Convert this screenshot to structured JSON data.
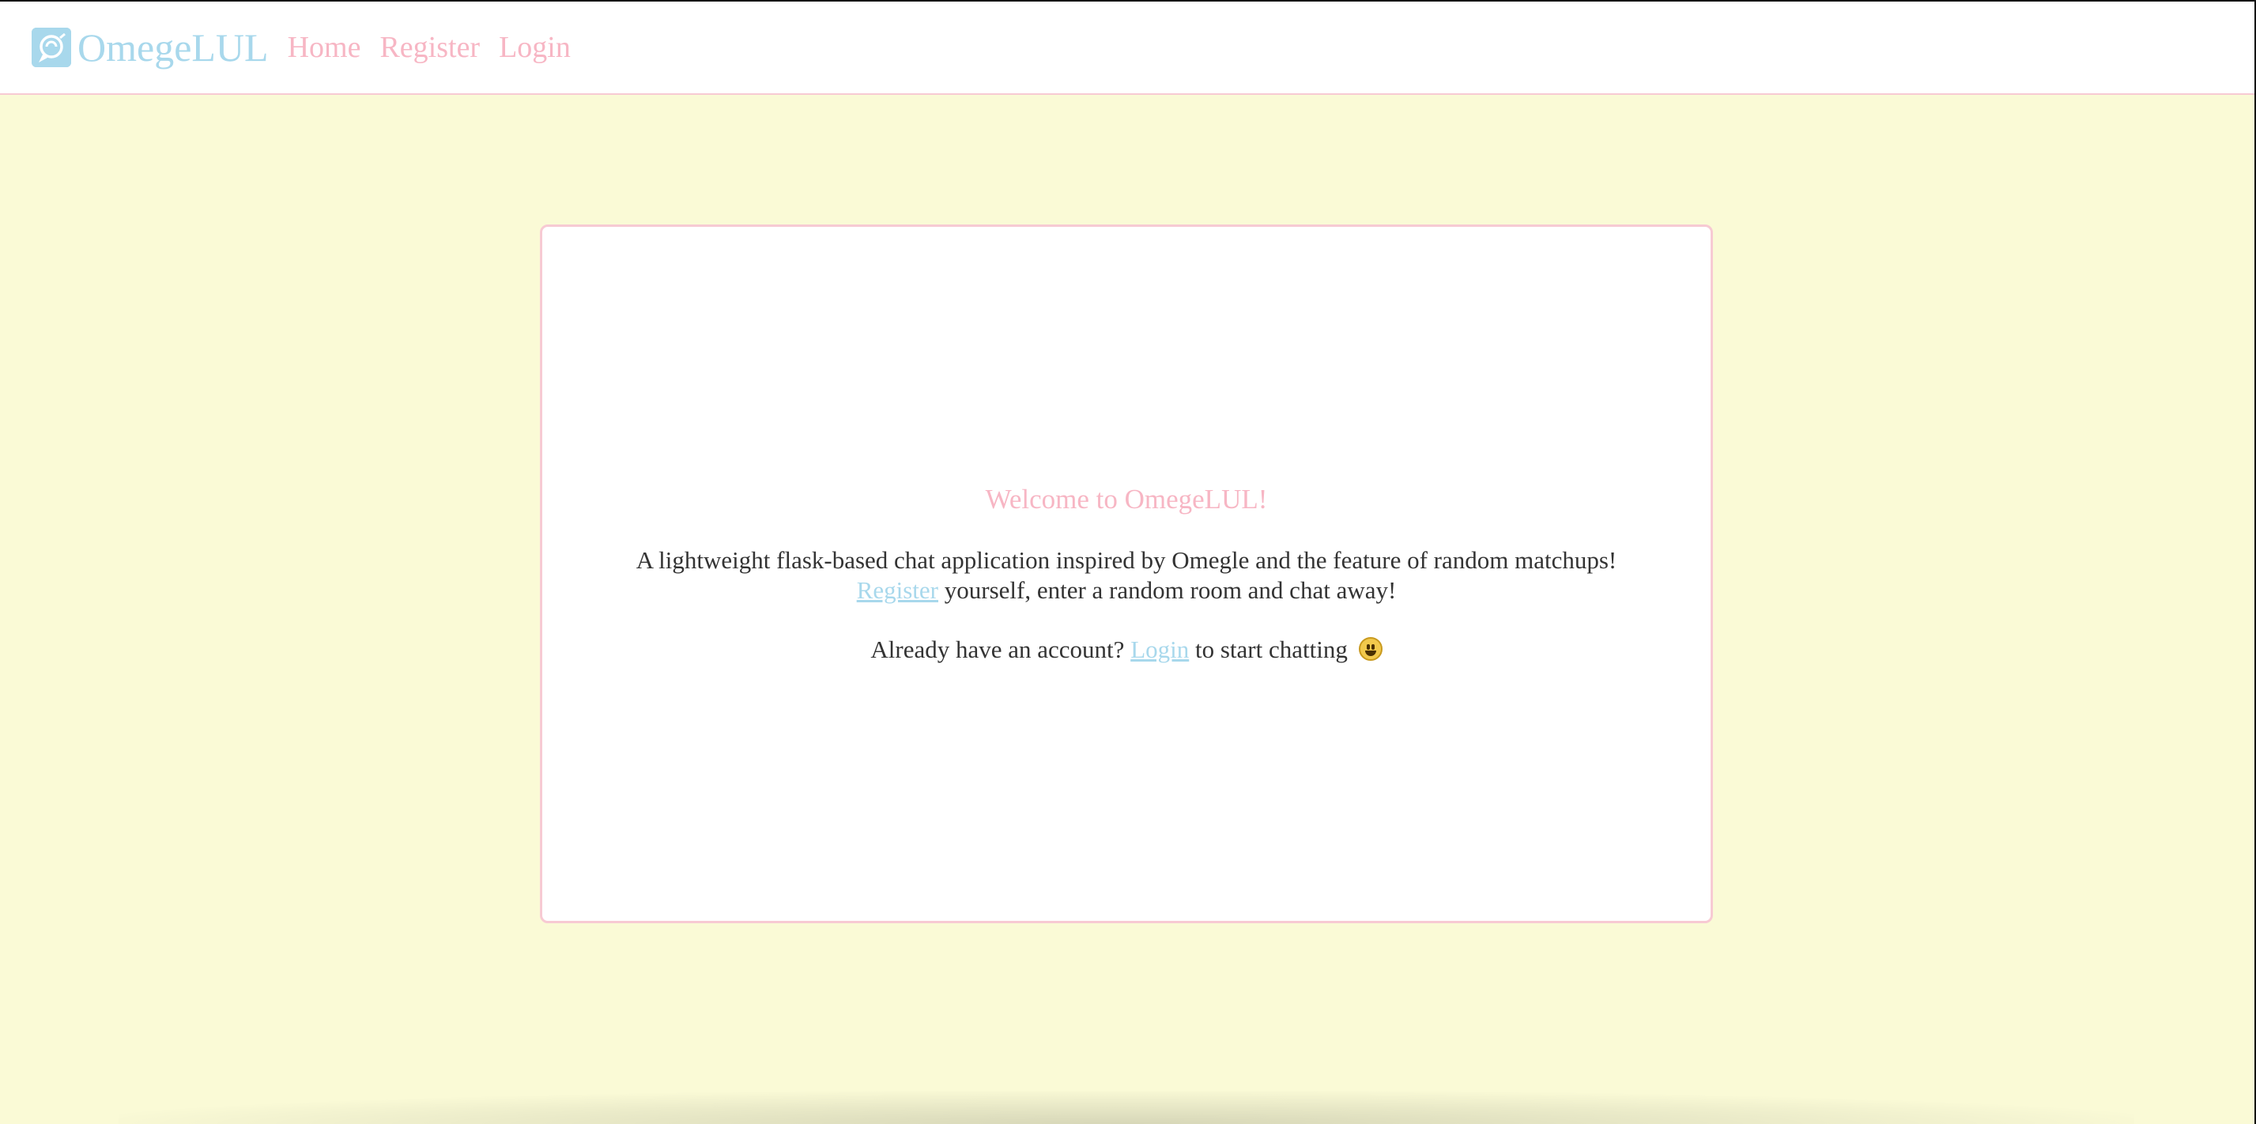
{
  "navbar": {
    "brand": "OmegeLUL",
    "links": [
      "Home",
      "Register",
      "Login"
    ]
  },
  "main": {
    "welcome_title": "Welcome to OmegeLUL!",
    "description_line1": "A lightweight flask-based chat application inspired by Omegle and the feature of random matchups!",
    "register_link": "Register",
    "description_line2_rest": " yourself, enter a random room and chat away!",
    "account_prompt": "Already have an account? ",
    "login_link": "Login",
    "account_rest": " to start chatting"
  },
  "colors": {
    "background": "#fafad6",
    "pink_accent": "#f7b6c4",
    "blue_accent": "#a8d8ec",
    "text": "#333333"
  },
  "icons": {
    "brand_logo": "chat-globe-icon",
    "emoji": "grinning-face-icon"
  }
}
